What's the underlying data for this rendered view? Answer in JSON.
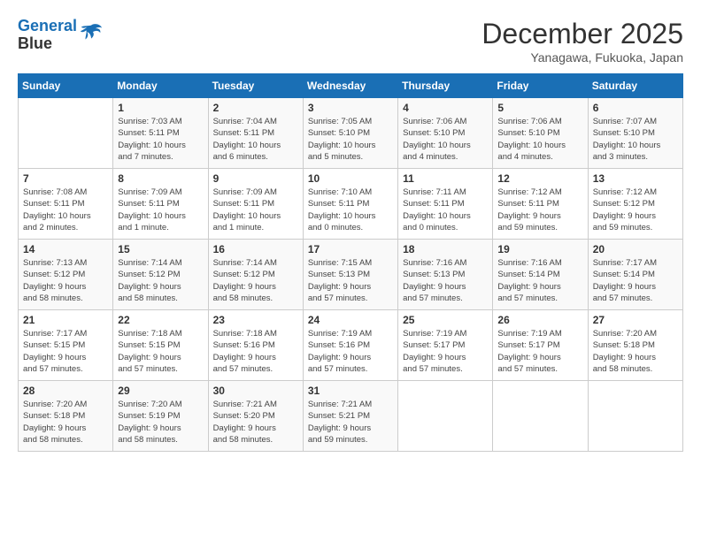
{
  "header": {
    "logo_line1": "General",
    "logo_line2": "Blue",
    "month": "December 2025",
    "location": "Yanagawa, Fukuoka, Japan"
  },
  "weekdays": [
    "Sunday",
    "Monday",
    "Tuesday",
    "Wednesday",
    "Thursday",
    "Friday",
    "Saturday"
  ],
  "weeks": [
    [
      null,
      {
        "day": "1",
        "sunrise": "7:03 AM",
        "sunset": "5:11 PM",
        "daylight": "10 hours and 7 minutes."
      },
      {
        "day": "2",
        "sunrise": "7:04 AM",
        "sunset": "5:11 PM",
        "daylight": "10 hours and 6 minutes."
      },
      {
        "day": "3",
        "sunrise": "7:05 AM",
        "sunset": "5:10 PM",
        "daylight": "10 hours and 5 minutes."
      },
      {
        "day": "4",
        "sunrise": "7:06 AM",
        "sunset": "5:10 PM",
        "daylight": "10 hours and 4 minutes."
      },
      {
        "day": "5",
        "sunrise": "7:06 AM",
        "sunset": "5:10 PM",
        "daylight": "10 hours and 4 minutes."
      },
      {
        "day": "6",
        "sunrise": "7:07 AM",
        "sunset": "5:10 PM",
        "daylight": "10 hours and 3 minutes."
      }
    ],
    [
      {
        "day": "7",
        "sunrise": "7:08 AM",
        "sunset": "5:11 PM",
        "daylight": "10 hours and 2 minutes."
      },
      {
        "day": "8",
        "sunrise": "7:09 AM",
        "sunset": "5:11 PM",
        "daylight": "10 hours and 1 minute."
      },
      {
        "day": "9",
        "sunrise": "7:09 AM",
        "sunset": "5:11 PM",
        "daylight": "10 hours and 1 minute."
      },
      {
        "day": "10",
        "sunrise": "7:10 AM",
        "sunset": "5:11 PM",
        "daylight": "10 hours and 0 minutes."
      },
      {
        "day": "11",
        "sunrise": "7:11 AM",
        "sunset": "5:11 PM",
        "daylight": "10 hours and 0 minutes."
      },
      {
        "day": "12",
        "sunrise": "7:12 AM",
        "sunset": "5:11 PM",
        "daylight": "9 hours and 59 minutes."
      },
      {
        "day": "13",
        "sunrise": "7:12 AM",
        "sunset": "5:12 PM",
        "daylight": "9 hours and 59 minutes."
      }
    ],
    [
      {
        "day": "14",
        "sunrise": "7:13 AM",
        "sunset": "5:12 PM",
        "daylight": "9 hours and 58 minutes."
      },
      {
        "day": "15",
        "sunrise": "7:14 AM",
        "sunset": "5:12 PM",
        "daylight": "9 hours and 58 minutes."
      },
      {
        "day": "16",
        "sunrise": "7:14 AM",
        "sunset": "5:12 PM",
        "daylight": "9 hours and 58 minutes."
      },
      {
        "day": "17",
        "sunrise": "7:15 AM",
        "sunset": "5:13 PM",
        "daylight": "9 hours and 57 minutes."
      },
      {
        "day": "18",
        "sunrise": "7:16 AM",
        "sunset": "5:13 PM",
        "daylight": "9 hours and 57 minutes."
      },
      {
        "day": "19",
        "sunrise": "7:16 AM",
        "sunset": "5:14 PM",
        "daylight": "9 hours and 57 minutes."
      },
      {
        "day": "20",
        "sunrise": "7:17 AM",
        "sunset": "5:14 PM",
        "daylight": "9 hours and 57 minutes."
      }
    ],
    [
      {
        "day": "21",
        "sunrise": "7:17 AM",
        "sunset": "5:15 PM",
        "daylight": "9 hours and 57 minutes."
      },
      {
        "day": "22",
        "sunrise": "7:18 AM",
        "sunset": "5:15 PM",
        "daylight": "9 hours and 57 minutes."
      },
      {
        "day": "23",
        "sunrise": "7:18 AM",
        "sunset": "5:16 PM",
        "daylight": "9 hours and 57 minutes."
      },
      {
        "day": "24",
        "sunrise": "7:19 AM",
        "sunset": "5:16 PM",
        "daylight": "9 hours and 57 minutes."
      },
      {
        "day": "25",
        "sunrise": "7:19 AM",
        "sunset": "5:17 PM",
        "daylight": "9 hours and 57 minutes."
      },
      {
        "day": "26",
        "sunrise": "7:19 AM",
        "sunset": "5:17 PM",
        "daylight": "9 hours and 57 minutes."
      },
      {
        "day": "27",
        "sunrise": "7:20 AM",
        "sunset": "5:18 PM",
        "daylight": "9 hours and 58 minutes."
      }
    ],
    [
      {
        "day": "28",
        "sunrise": "7:20 AM",
        "sunset": "5:18 PM",
        "daylight": "9 hours and 58 minutes."
      },
      {
        "day": "29",
        "sunrise": "7:20 AM",
        "sunset": "5:19 PM",
        "daylight": "9 hours and 58 minutes."
      },
      {
        "day": "30",
        "sunrise": "7:21 AM",
        "sunset": "5:20 PM",
        "daylight": "9 hours and 58 minutes."
      },
      {
        "day": "31",
        "sunrise": "7:21 AM",
        "sunset": "5:21 PM",
        "daylight": "9 hours and 59 minutes."
      },
      null,
      null,
      null
    ]
  ]
}
